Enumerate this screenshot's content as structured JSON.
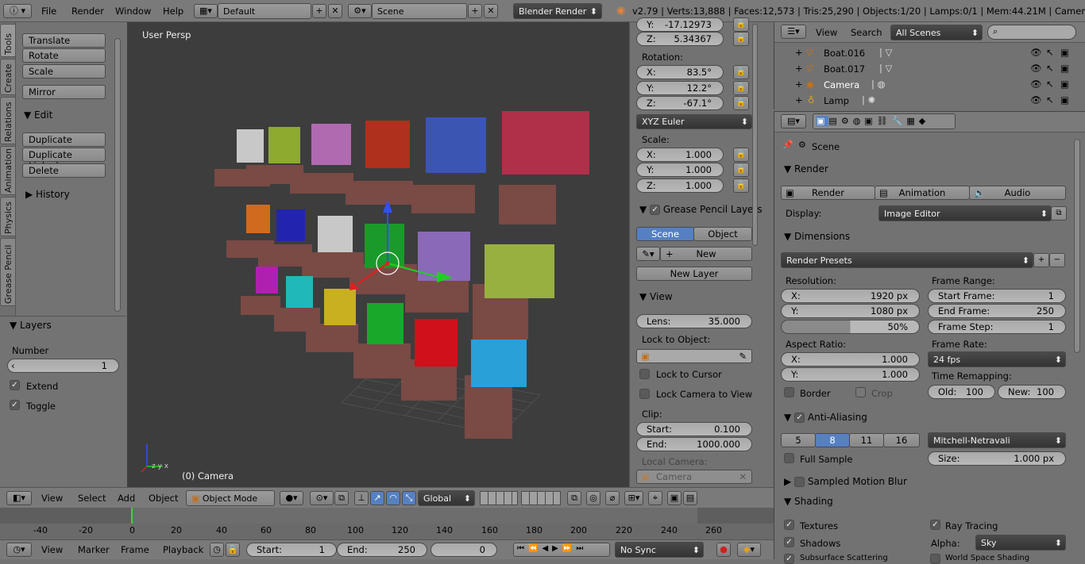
{
  "topbar": {
    "menus": [
      "File",
      "Render",
      "Window",
      "Help"
    ],
    "screen_layout": "Default",
    "scene": "Scene",
    "engine": "Blender Render",
    "stats": "v2.79 | Verts:13,888 | Faces:12,573 | Tris:25,290 | Objects:1/20 | Lamps:0/1 | Mem:44.21M | Camera"
  },
  "tool_tabs": [
    "Tools",
    "Create",
    "Relations",
    "Animation",
    "Physics",
    "Grease Pencil"
  ],
  "tools": {
    "transform_buttons": [
      "Translate",
      "Rotate",
      "Scale"
    ],
    "mirror": "Mirror",
    "edit_heading": "Edit",
    "edit_buttons": [
      "Duplicate",
      "Duplicate Linked",
      "Delete"
    ],
    "history_heading": "History"
  },
  "layers_panel": {
    "heading": "Layers",
    "number_label": "Number",
    "number_value": "1",
    "extend": "Extend",
    "toggle": "Toggle"
  },
  "viewport": {
    "view_label": "User Persp",
    "object_label": "(0) Camera"
  },
  "npanel": {
    "loc_y": "-17.12973",
    "loc_z": "5.34367",
    "rotation_label": "Rotation:",
    "rot_x": "83.5°",
    "rot_y": "12.2°",
    "rot_z": "-67.1°",
    "rotation_mode": "XYZ Euler",
    "scale_label": "Scale:",
    "scale_x": "1.000",
    "scale_y": "1.000",
    "scale_z": "1.000",
    "gp_heading": "Grease Pencil Layers",
    "gp_scene": "Scene",
    "gp_object": "Object",
    "gp_new": "New",
    "gp_new_layer": "New Layer",
    "view_heading": "View",
    "lens_label": "Lens:",
    "lens_value": "35.000",
    "lock_to_object": "Lock to Object:",
    "lock_to_cursor": "Lock to Cursor",
    "lock_camera": "Lock Camera to View",
    "clip_label": "Clip:",
    "clip_start_label": "Start:",
    "clip_start": "0.100",
    "clip_end_label": "End:",
    "clip_end": "1000.000",
    "local_camera": "Local Camera:",
    "local_camera_value": "Camera"
  },
  "outliner": {
    "menus": [
      "View",
      "Search"
    ],
    "display_mode": "All Scenes",
    "rows": [
      "Boat.016",
      "Boat.017",
      "Camera",
      "Lamp"
    ]
  },
  "properties": {
    "context": "Scene",
    "render_heading": "Render",
    "render_btn": "Render",
    "animation_btn": "Animation",
    "audio_btn": "Audio",
    "display_label": "Display:",
    "display_value": "Image Editor",
    "dimensions_heading": "Dimensions",
    "render_presets": "Render Presets",
    "resolution_label": "Resolution:",
    "res_x": "1920 px",
    "res_y": "1080 px",
    "res_pct": "50%",
    "frame_range_label": "Frame Range:",
    "start_frame_label": "Start Frame:",
    "start_frame": "1",
    "end_frame_label": "End Frame:",
    "end_frame": "250",
    "frame_step_label": "Frame Step:",
    "frame_step": "1",
    "aspect_label": "Aspect Ratio:",
    "aspect_x": "1.000",
    "aspect_y": "1.000",
    "frame_rate_label": "Frame Rate:",
    "frame_rate": "24 fps",
    "time_remap_label": "Time Remapping:",
    "old_label": "Old:",
    "old_value": "100",
    "new_label": "New:",
    "new_value": "100",
    "border": "Border",
    "crop": "Crop",
    "aa_heading": "Anti-Aliasing",
    "aa_samples": [
      "5",
      "8",
      "11",
      "16"
    ],
    "aa_selected": "8",
    "aa_filter": "Mitchell-Netravali",
    "full_sample": "Full Sample",
    "size_label": "Size:",
    "size_value": "1.000 px",
    "motion_blur_heading": "Sampled Motion Blur",
    "shading_heading": "Shading",
    "textures": "Textures",
    "ray_tracing": "Ray Tracing",
    "shadows": "Shadows",
    "alpha_label": "Alpha:",
    "alpha_value": "Sky",
    "sss": "Subsurface Scattering",
    "world_space": "World Space Shading"
  },
  "view3d_header": {
    "menus": [
      "View",
      "Select",
      "Add",
      "Object"
    ],
    "mode": "Object Mode",
    "orientation": "Global"
  },
  "timeline": {
    "ticks": [
      "-40",
      "-20",
      "0",
      "20",
      "40",
      "60",
      "80",
      "100",
      "120",
      "140",
      "160",
      "180",
      "200",
      "220",
      "240",
      "260"
    ],
    "menus": [
      "View",
      "Marker",
      "Frame",
      "Playback"
    ],
    "start_label": "Start:",
    "start_value": "1",
    "end_label": "End:",
    "end_value": "250",
    "current_frame": "0",
    "sync": "No Sync"
  },
  "colors": {
    "accent_blue": "#5680c2",
    "viewport_bg": "#3d3d3d",
    "panel_bg": "#727272"
  }
}
